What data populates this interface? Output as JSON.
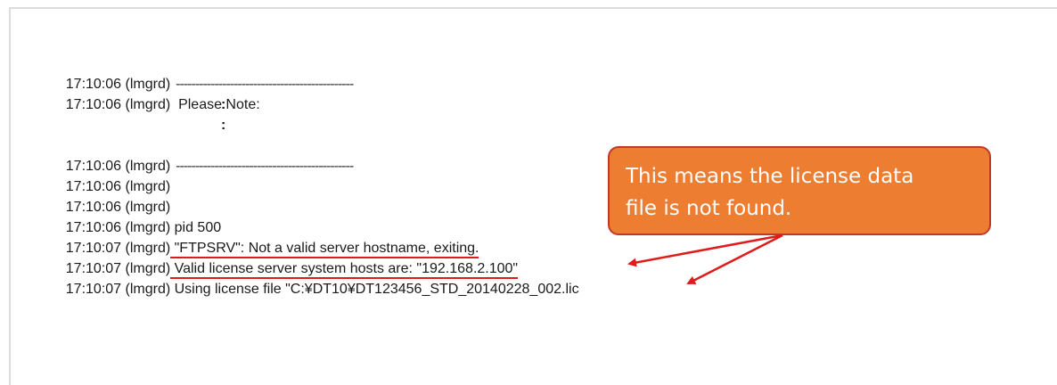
{
  "log": {
    "lines": [
      {
        "ts": "17:10:06 (lmgrd)",
        "text": "",
        "dashes": "----------------------------------------------"
      },
      {
        "ts": "17:10:06 (lmgrd)",
        "text": "  Please Note:"
      },
      {
        "colon": ":"
      },
      {
        "colon": ":"
      },
      {
        "ts": "17:10:06 (lmgrd)",
        "text": "",
        "dashes": "----------------------------------------------"
      },
      {
        "ts": "17:10:06 (lmgrd)",
        "text": ""
      },
      {
        "ts": "17:10:06 (lmgrd)",
        "text": ""
      },
      {
        "ts": "17:10:06 (lmgrd)",
        "text": " pid 500"
      },
      {
        "ts": "17:10:07 (lmgrd)",
        "text": " \"FTPSRV\": Not a valid server hostname, exiting."
      },
      {
        "ts": "17:10:07 (lmgrd)",
        "text": " Valid license server system hosts are: \"192.168.2.100\""
      },
      {
        "ts": "17:10:07 (lmgrd)",
        "text": " Using license file \"C:¥DT10¥DT123456_STD_20140228_002.lic"
      }
    ]
  },
  "callout": {
    "line1": "This means the license data",
    "line2": "file is not found."
  },
  "colors": {
    "callout_fill": "#ed7d31",
    "callout_border": "#c0392b",
    "annotation_red": "#e01b1b"
  }
}
